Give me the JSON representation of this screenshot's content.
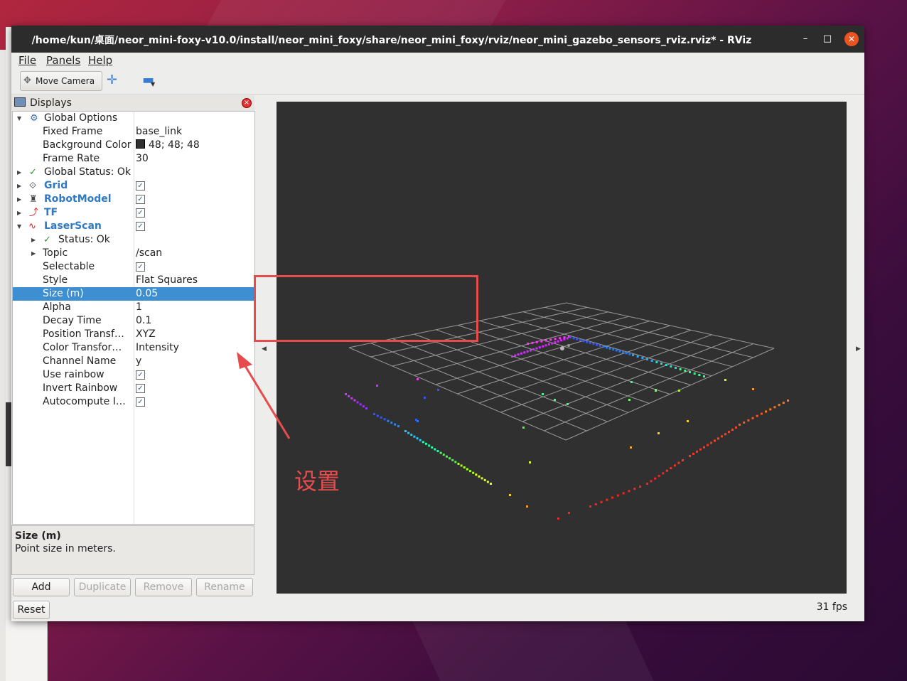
{
  "window": {
    "title": "/home/kun/桌面/neor_mini-foxy-v10.0/install/neor_mini_foxy/share/neor_mini_foxy/rviz/neor_mini_gazebo_sensors_rviz.rviz* - RViz",
    "controls": {
      "minimize": "–",
      "maximize": "□",
      "close": "✕"
    }
  },
  "menubar": {
    "file": "File",
    "panels": "Panels",
    "help": "Help"
  },
  "toolbar": {
    "move_camera": "Move Camera",
    "plus": "✛",
    "minus": "▬"
  },
  "displays_panel": {
    "title": "Displays",
    "rows": [
      {
        "name": "Global Options",
        "value": ""
      },
      {
        "name": "Fixed Frame",
        "value": "base_link"
      },
      {
        "name": "Background Color",
        "value": "48; 48; 48"
      },
      {
        "name": "Frame Rate",
        "value": "30"
      },
      {
        "name": "Global Status: Ok",
        "value": ""
      },
      {
        "name": "Grid",
        "value": "✓"
      },
      {
        "name": "RobotModel",
        "value": "✓"
      },
      {
        "name": "TF",
        "value": "✓"
      },
      {
        "name": "LaserScan",
        "value": "✓"
      },
      {
        "name": "Status: Ok",
        "value": ""
      },
      {
        "name": "Topic",
        "value": "/scan"
      },
      {
        "name": "Selectable",
        "value": "✓"
      },
      {
        "name": "Style",
        "value": "Flat Squares"
      },
      {
        "name": "Size (m)",
        "value": "0.05"
      },
      {
        "name": "Alpha",
        "value": "1"
      },
      {
        "name": "Decay Time",
        "value": "0.1"
      },
      {
        "name": "Position Transf…",
        "value": "XYZ"
      },
      {
        "name": "Color Transfor…",
        "value": "Intensity"
      },
      {
        "name": "Channel Name",
        "value": "y"
      },
      {
        "name": "Use rainbow",
        "value": "✓"
      },
      {
        "name": "Invert Rainbow",
        "value": "✓"
      },
      {
        "name": "Autocompute I…",
        "value": "✓"
      }
    ],
    "selected_row": "Size (m)",
    "description": {
      "heading": "Size (m)",
      "text": "Point size in meters."
    },
    "buttons": {
      "add": "Add",
      "duplicate": "Duplicate",
      "remove": "Remove",
      "rename": "Rename",
      "reset": "Reset"
    }
  },
  "viewport": {
    "background_color": "#303030",
    "fps": "31 fps"
  },
  "annotation": {
    "label": "设置",
    "color": "#e74c4c"
  },
  "icons": {
    "global_options": "gear-icon",
    "global_status": "check-icon",
    "grid": "grid-icon",
    "robot_model": "robot-icon",
    "tf": "tf-axes-icon",
    "laser_scan": "laser-scan-icon",
    "status_ok": "check-icon"
  }
}
